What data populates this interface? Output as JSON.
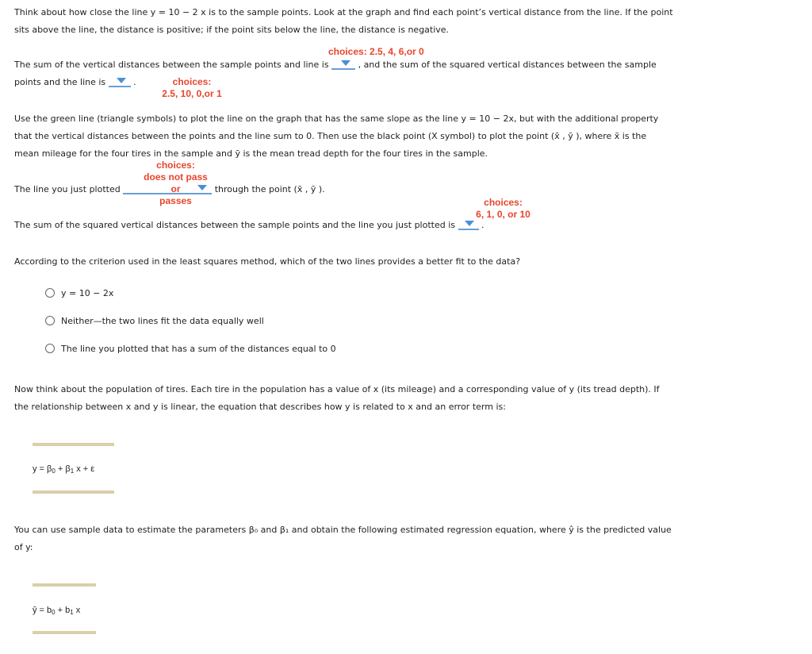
{
  "intro": {
    "line1": "Think about how close the line y = 10 − 2 x is to the sample points. Look at the graph and find each point’s vertical distance from the line. If the point",
    "line2": "sits above the line, the distance is positive; if the point sits below the line, the distance is negative."
  },
  "q1": {
    "choices_hint_1": "choices: 2.5, 4, 6,or 0",
    "text_a": "The sum of the vertical distances between the sample points and line is",
    "text_b": ", and the sum of the squared vertical distances between the sample",
    "text_c": "points and the line is",
    "text_d": ".",
    "choices_hint_2a": "choices:",
    "choices_hint_2b": "2.5, 10, 0,or 1",
    "dropdown1_value": "",
    "dropdown2_value": ""
  },
  "plot_instr": {
    "line1": "Use the green line (triangle symbols) to plot the line on the graph that has the same slope as the line y = 10 − 2x, but with the additional property",
    "line2": "that the vertical distances between the points and the line sum to 0. Then use the black point (X symbol) to plot the point (x̄ , ȳ ), where x̄  is the",
    "line3": "mean mileage for the four tires in the sample and ȳ  is the mean tread depth for the four tires in the sample."
  },
  "q2": {
    "choices_a": "choices:",
    "choices_b": "does not pass",
    "choices_c": "or",
    "choices_d": "passes",
    "text_a": "The line you just plotted",
    "text_b": "through the point (x̄ , ȳ ).",
    "dropdown_value": ""
  },
  "q3": {
    "choices_a": "choices:",
    "choices_b": "6, 1, 0, or 10",
    "text_a": "The sum of the squared vertical distances between the sample points and the line you just plotted is",
    "text_b": ".",
    "dropdown_value": ""
  },
  "q4": {
    "question": "According to the criterion used in the least squares method, which of the two lines provides a better fit to the data?",
    "options": [
      "y = 10 − 2x",
      "Neither—the two lines fit the data equally well",
      "The line you plotted that has a sum of the distances equal to 0"
    ],
    "selected": null
  },
  "population": {
    "line1": "Now think about the population of tires. Each tire in the population has a value of x (its mileage) and a corresponding value of y (its tread depth). If",
    "line2": "the relationship between x and y is linear, the equation that describes how y is related to x and an error term is:"
  },
  "model_eq": {
    "y": "y = β",
    "sub0": "0",
    "mid": " + β",
    "sub1": "1",
    "end": " x + ε"
  },
  "estimate": {
    "line1": "You can use sample data to estimate the parameters β₀ and β₁ and obtain the following estimated regression equation, where ŷ is the predicted value",
    "line2": "of y:"
  },
  "est_eq": {
    "y": "ŷ = b",
    "sub0": "0",
    "mid": " + b",
    "sub1": "1",
    "end": " x"
  },
  "colors": {
    "hint_red": "#e8452c",
    "dropdown_blue": "#6a9fd4",
    "equation_bar": "#d9cfa8"
  }
}
